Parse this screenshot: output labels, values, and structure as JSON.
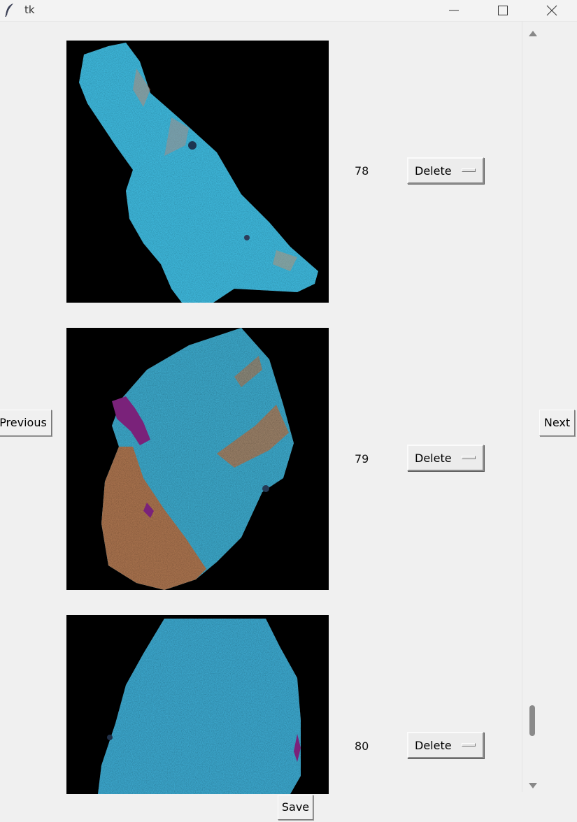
{
  "window": {
    "title": "tk",
    "app_icon": "feather-icon",
    "controls": [
      "minimize-icon",
      "maximize-icon",
      "close-icon"
    ]
  },
  "navigation": {
    "previous_label": "Previous",
    "next_label": "Next"
  },
  "rows": [
    {
      "id": "78",
      "option_value": "Delete"
    },
    {
      "id": "79",
      "option_value": "Delete"
    },
    {
      "id": "80",
      "option_value": "Delete"
    }
  ],
  "footer": {
    "save_label": "Save"
  },
  "scrollbar": {
    "position": 0.95
  },
  "colors": {
    "window_bg": "#f0f0f0",
    "image_bg": "#000000",
    "mineral_blue": "#3db3d6",
    "mineral_orange": "#b0784a",
    "mineral_purple": "#7a2a7a"
  }
}
